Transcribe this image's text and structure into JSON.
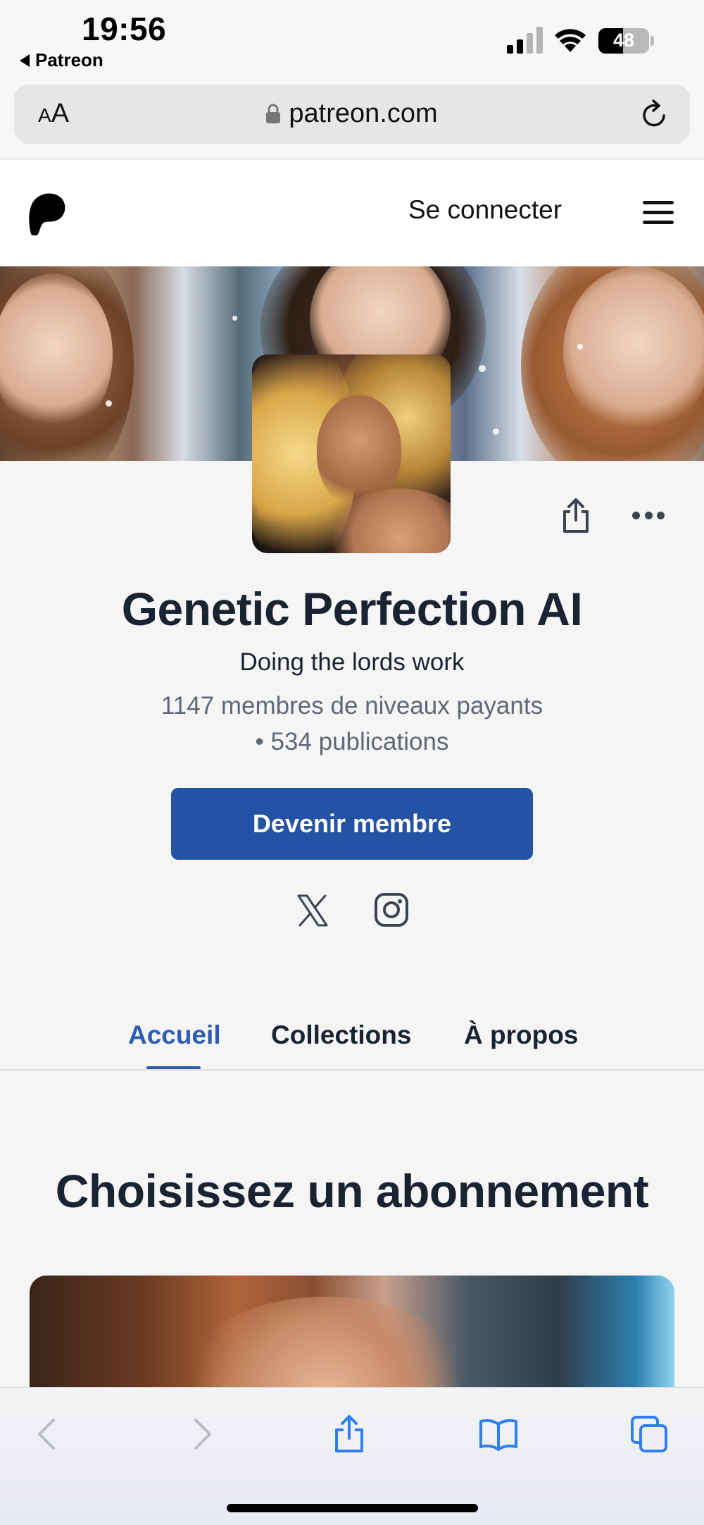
{
  "status_bar": {
    "time": "19:56",
    "back_app": "Patreon",
    "battery": "48"
  },
  "browser": {
    "text_size_label_small": "A",
    "text_size_label_large": "A",
    "url": "patreon.com"
  },
  "header": {
    "login_label": "Se connecter"
  },
  "profile": {
    "name": "Genetic Perfection AI",
    "tagline": "Doing the lords work",
    "members_stat": "1147 membres de niveaux payants",
    "posts_stat": "• 534 publications",
    "join_button": "Devenir membre"
  },
  "tabs": [
    {
      "label": "Accueil",
      "active": true
    },
    {
      "label": "Collections",
      "active": false
    },
    {
      "label": "À propos",
      "active": false
    }
  ],
  "section": {
    "title": "Choisissez un abonnement"
  },
  "colors": {
    "accent": "#2452a4",
    "tab_active": "#2d5db3",
    "text_dark": "#1a2332",
    "text_muted": "#5f6873"
  },
  "icons": [
    "signal-icon",
    "wifi-icon",
    "lock-icon",
    "reload-icon",
    "patreon-logo",
    "menu-icon",
    "share-icon",
    "more-icon",
    "x-twitter-icon",
    "instagram-icon",
    "back-arrow-icon",
    "forward-arrow-icon",
    "safari-share-icon",
    "bookmarks-icon",
    "tabs-icon"
  ]
}
